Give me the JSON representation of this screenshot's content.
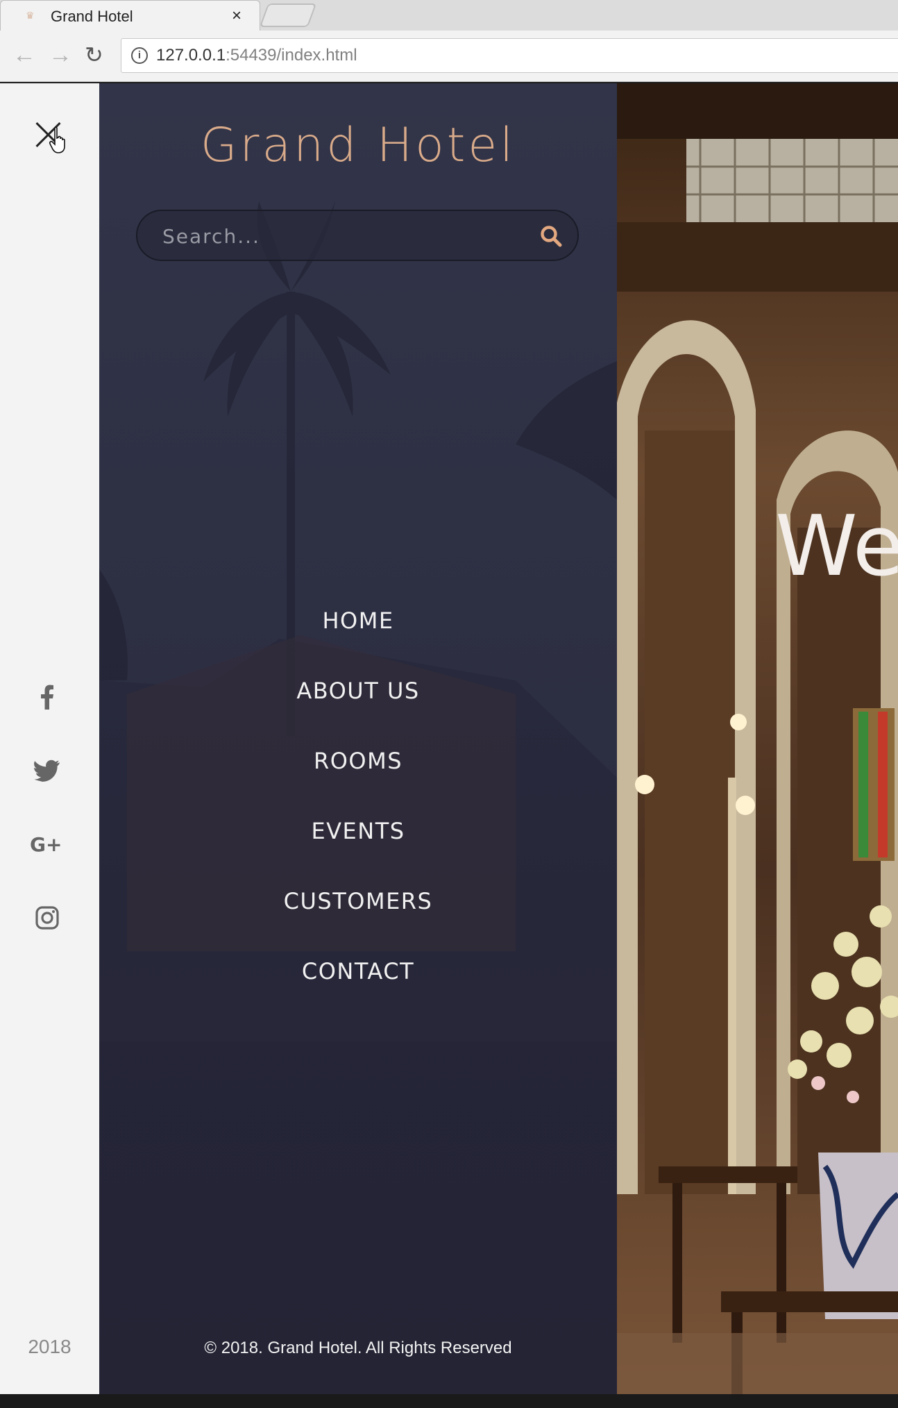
{
  "browser": {
    "tab_title": "Grand Hotel",
    "tab_close": "×",
    "url_host": "127.0.0.1",
    "url_rest": ":54439/index.html",
    "back_icon": "arrow-left-icon",
    "forward_icon": "arrow-right-icon",
    "reload_icon": "reload-icon",
    "info_icon": "info-icon"
  },
  "rail": {
    "close_icon": "close-icon",
    "socials": [
      "facebook-icon",
      "twitter-icon",
      "google-plus-icon",
      "instagram-icon"
    ],
    "year": "2018"
  },
  "drawer": {
    "logo": "Grand Hotel",
    "search": {
      "placeholder": "Search..."
    },
    "menu": [
      "HOME",
      "ABOUT US",
      "ROOMS",
      "EVENTS",
      "CUSTOMERS",
      "CONTACT"
    ],
    "copyright": "© 2018. Grand Hotel. All Rights Reserved"
  },
  "hero": {
    "headline_partial": "We"
  },
  "colors": {
    "accent": "#d9ab8a",
    "drawer_bg": "#2e3045",
    "rail_bg": "#f3f3f3"
  }
}
